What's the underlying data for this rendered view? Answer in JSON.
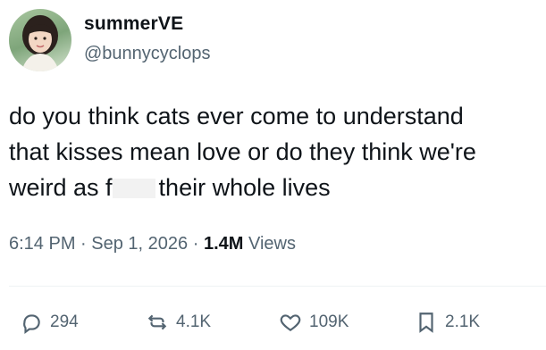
{
  "author": {
    "display_name": "summerVE",
    "handle": "@bunnycyclops"
  },
  "tweet": {
    "line1": "do you think cats ever come to understand",
    "line2": "that kisses mean love or do they think we're",
    "line3_before": "weird as f",
    "line3_after": "their whole lives"
  },
  "meta": {
    "time": "6:14 PM",
    "sep1": "·",
    "date": "Sep 1, 2026",
    "sep2": "·",
    "views_count": "1.4M",
    "views_label": "Views"
  },
  "actions": {
    "replies": "294",
    "reposts": "4.1K",
    "likes": "109K",
    "bookmarks": "2.1K"
  }
}
